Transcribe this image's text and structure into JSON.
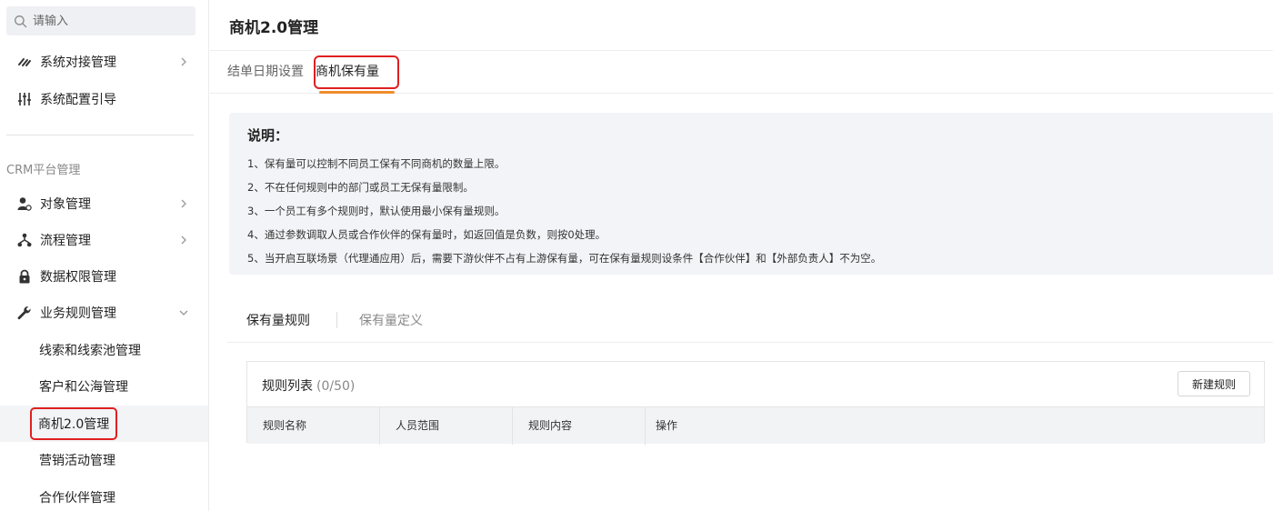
{
  "search": {
    "placeholder": "请输入"
  },
  "sidebar": {
    "top_items": [
      {
        "label": "系统对接管理",
        "icon": "link-icon",
        "has_chevron": true
      },
      {
        "label": "系统配置引导",
        "icon": "sliders-icon",
        "has_chevron": false
      }
    ],
    "section_title": "CRM平台管理",
    "items": [
      {
        "label": "对象管理",
        "icon": "user-settings-icon",
        "chevron": "right"
      },
      {
        "label": "流程管理",
        "icon": "flow-icon",
        "chevron": "right"
      },
      {
        "label": "数据权限管理",
        "icon": "lock-icon",
        "chevron": ""
      },
      {
        "label": "业务规则管理",
        "icon": "wrench-icon",
        "chevron": "down"
      }
    ],
    "sub_items": [
      {
        "label": "线索和线索池管理"
      },
      {
        "label": "客户和公海管理"
      },
      {
        "label": "商机2.0管理",
        "active": true
      },
      {
        "label": "营销活动管理"
      },
      {
        "label": "合作伙伴管理"
      }
    ]
  },
  "main": {
    "title": "商机2.0管理",
    "tabs": [
      {
        "label": "结单日期设置"
      },
      {
        "label": "商机保有量",
        "active": true
      }
    ],
    "description": {
      "heading": "说明：",
      "lines": [
        "1、保有量可以控制不同员工保有不同商机的数量上限。",
        "2、不在任何规则中的部门或员工无保有量限制。",
        "3、一个员工有多个规则时，默认使用最小保有量规则。",
        "4、通过参数调取人员或合作伙伴的保有量时，如返回值是负数，则按0处理。",
        "5、当开启互联场景（代理通应用）后，需要下游伙伴不占有上游保有量，可在保有量规则设条件【合作伙伴】和【外部负责人】不为空。"
      ]
    },
    "sub_tabs": [
      {
        "label": "保有量规则",
        "active": true
      },
      {
        "label": "保有量定义"
      }
    ],
    "rules_panel": {
      "title": "规则列表",
      "count": "(0/50)",
      "new_button": "新建规则",
      "columns": [
        "规则名称",
        "人员范围",
        "规则内容",
        "操作"
      ]
    }
  },
  "colors": {
    "highlight_border": "#e02020",
    "tab_underline": "#f08c2c",
    "description_bg": "#f2f4f7",
    "table_header_bg": "#f2f3f5"
  }
}
